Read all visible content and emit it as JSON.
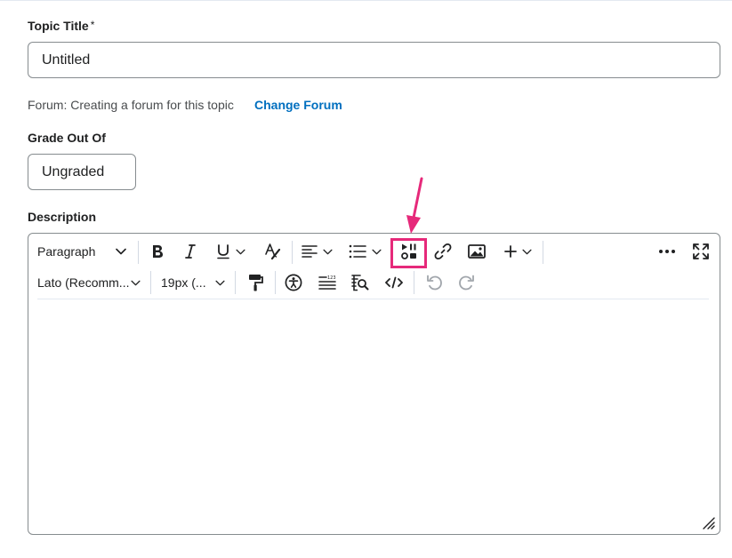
{
  "topic_title": {
    "label": "Topic Title",
    "required_marker": "*",
    "value": "Untitled"
  },
  "forum": {
    "text": "Forum: Creating a forum for this topic",
    "link": "Change Forum"
  },
  "grade": {
    "label": "Grade Out Of",
    "value": "Ungraded"
  },
  "description": {
    "label": "Description",
    "toolbar": {
      "block_format": "Paragraph",
      "font_family": "Lato (Recomm...",
      "font_size": "19px (...",
      "highlighted_tool": "insert-stuff-icon"
    }
  },
  "colors": {
    "accent": "#006fbf",
    "highlight": "#e6297a",
    "border": "#868c8f"
  }
}
